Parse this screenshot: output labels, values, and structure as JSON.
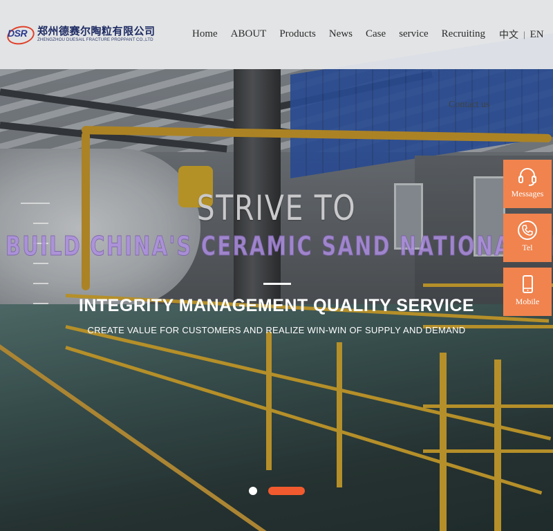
{
  "header": {
    "logo": {
      "mark": "DSR",
      "name_cn": "郑州德赛尔陶粒有限公司",
      "name_en": "ZHENGZHOU DUESAIL FRACTURE PROPPANT CO.,LTD"
    },
    "nav": [
      "Home",
      "ABOUT",
      "Products",
      "News",
      "Case",
      "service",
      "Recruiting"
    ],
    "lang": {
      "cn": "中文",
      "separator": "|",
      "en": "EN"
    }
  },
  "hero": {
    "contact_link": "Contact us",
    "title_line1": "STRIVE TO",
    "title_line2": "BUILD CHINA'S CERAMIC SAND NATIONAL BR",
    "slogan": "INTEGRITY MANAGEMENT QUALITY SERVICE",
    "sub_slogan": "CREATE VALUE FOR CUSTOMERS AND REALIZE WIN-WIN OF SUPPLY AND DEMAND"
  },
  "float_bar": {
    "accent_color": "#f0834e",
    "items": [
      {
        "label": "Messages",
        "icon": "headset-icon"
      },
      {
        "label": "Tel",
        "icon": "phone-icon"
      },
      {
        "label": "Mobile",
        "icon": "mobile-icon"
      }
    ]
  },
  "carousel": {
    "slide_count": 2,
    "active_slide": 2,
    "active_color": "#f15a2e"
  }
}
